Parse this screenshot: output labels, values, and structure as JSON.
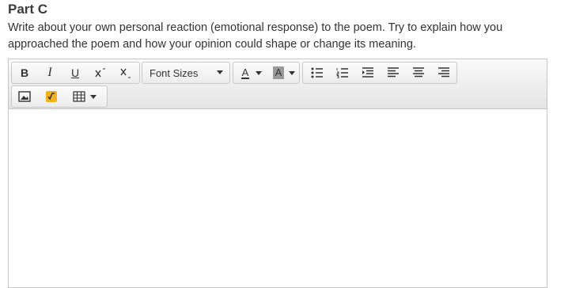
{
  "section": {
    "heading": "Part C",
    "prompt": "Write about your own personal reaction (emotional response) to the poem. Try to explain how you approached the poem and how your opinion could shape or change its meaning."
  },
  "toolbar": {
    "bold_label": "B",
    "italic_label": "I",
    "underline_label": "U",
    "font_sizes_label": "Font Sizes",
    "text_color_label": "A",
    "bg_color_label": "A",
    "bg_color_swatch": "#999999",
    "math_accent": "#f2b21c"
  },
  "editor": {
    "content": ""
  }
}
